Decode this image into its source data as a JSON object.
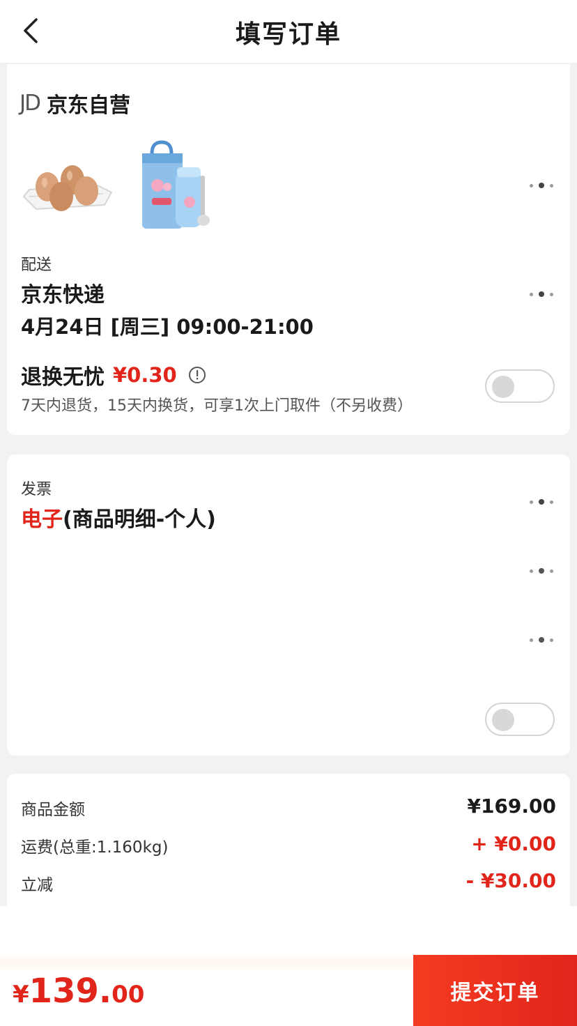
{
  "header": {
    "title": "填写订单",
    "back_icon": "chevron-left-icon"
  },
  "seller": {
    "logo_text": "JD",
    "name": "京东自营"
  },
  "products": [
    {
      "icon": "eggs-product-image"
    },
    {
      "icon": "lunch-bag-thermos-product-image"
    }
  ],
  "delivery": {
    "label": "配送",
    "carrier": "京东快递",
    "time": "4月24日 [周三] 09:00-21:00"
  },
  "return_service": {
    "title": "退换无忧",
    "price": "¥0.30",
    "description": "7天内退货，15天内换货，可享1次上门取件（不另收费）",
    "enabled": false
  },
  "invoice": {
    "label": "发票",
    "type": "电子",
    "detail": "(商品明细-个人)"
  },
  "summary": {
    "rows": [
      {
        "label": "商品金额",
        "value": "¥169.00",
        "color": "#1a1a1a"
      },
      {
        "label": "运费(总重:1.160kg)",
        "value": "+ ¥0.00",
        "color": "#e1251b"
      },
      {
        "label": "立减",
        "value": "- ¥30.00",
        "color": "#e1251b"
      }
    ]
  },
  "bottom": {
    "currency": "¥",
    "total_int": "139.",
    "total_dec": "00",
    "submit_label": "提交订单"
  },
  "colors": {
    "accent": "#e1251b",
    "background": "#f2f2f2"
  }
}
